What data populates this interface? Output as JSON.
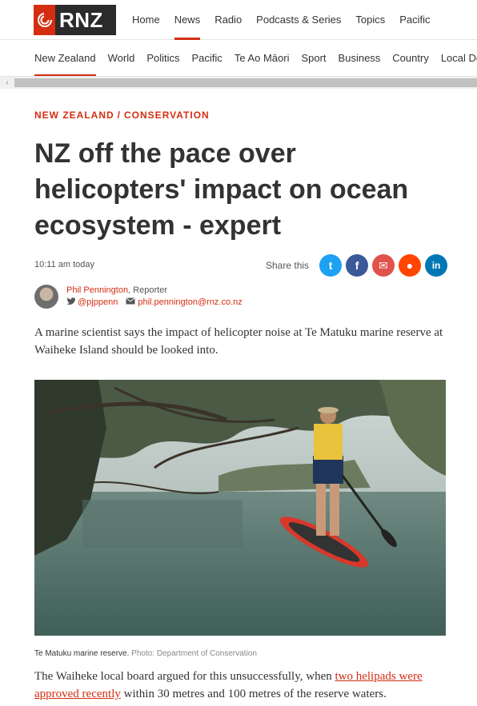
{
  "brand": {
    "name": "RNZ"
  },
  "topnav": [
    {
      "label": "Home",
      "active": false
    },
    {
      "label": "News",
      "active": true
    },
    {
      "label": "Radio",
      "active": false
    },
    {
      "label": "Podcasts & Series",
      "active": false
    },
    {
      "label": "Topics",
      "active": false
    },
    {
      "label": "Pacific",
      "active": false
    }
  ],
  "secnav": [
    {
      "label": "New Zealand",
      "active": true
    },
    {
      "label": "World",
      "active": false
    },
    {
      "label": "Politics",
      "active": false
    },
    {
      "label": "Pacific",
      "active": false
    },
    {
      "label": "Te Ao Māori",
      "active": false
    },
    {
      "label": "Sport",
      "active": false
    },
    {
      "label": "Business",
      "active": false
    },
    {
      "label": "Country",
      "active": false
    },
    {
      "label": "Local Democracy",
      "active": false
    }
  ],
  "article": {
    "kicker_section": "NEW ZEALAND",
    "kicker_separator": "/",
    "kicker_topic": "CONSERVATION",
    "headline": "NZ off the pace over helicopters' impact on ocean ecosystem - expert",
    "time": "10:11 am today",
    "share_label": "Share this",
    "author_name": "Phil Pennington",
    "author_role": ", Reporter",
    "author_twitter": "@pjppenn",
    "author_email": "phil.pennington@rnz.co.nz",
    "lede": "A marine scientist says the impact of helicopter noise at Te Matuku marine reserve at Waiheke Island should be looked into.",
    "caption": "Te Matuku marine reserve.",
    "caption_credit": "Photo: Department of Conservation",
    "body_before": "The Waiheke local board argued for this unsuccessfully, when ",
    "body_link": "two helipads were approved recently",
    "body_after": " within 30 metres and 100 metres of the reserve waters."
  },
  "share_buttons": [
    {
      "name": "twitter-share-button",
      "icon": "twitter-icon",
      "color": "#1da1f2",
      "glyph": "t"
    },
    {
      "name": "facebook-share-button",
      "icon": "facebook-icon",
      "color": "#3b5998",
      "glyph": "f"
    },
    {
      "name": "email-share-button",
      "icon": "email-icon",
      "color": "#e0524a",
      "glyph": "✉"
    },
    {
      "name": "reddit-share-button",
      "icon": "reddit-icon",
      "color": "#ff4500",
      "glyph": "●"
    },
    {
      "name": "linkedin-share-button",
      "icon": "linkedin-icon",
      "color": "#0077b5",
      "glyph": "in"
    }
  ],
  "colors": {
    "accent": "#d42e12",
    "text": "#333333"
  }
}
